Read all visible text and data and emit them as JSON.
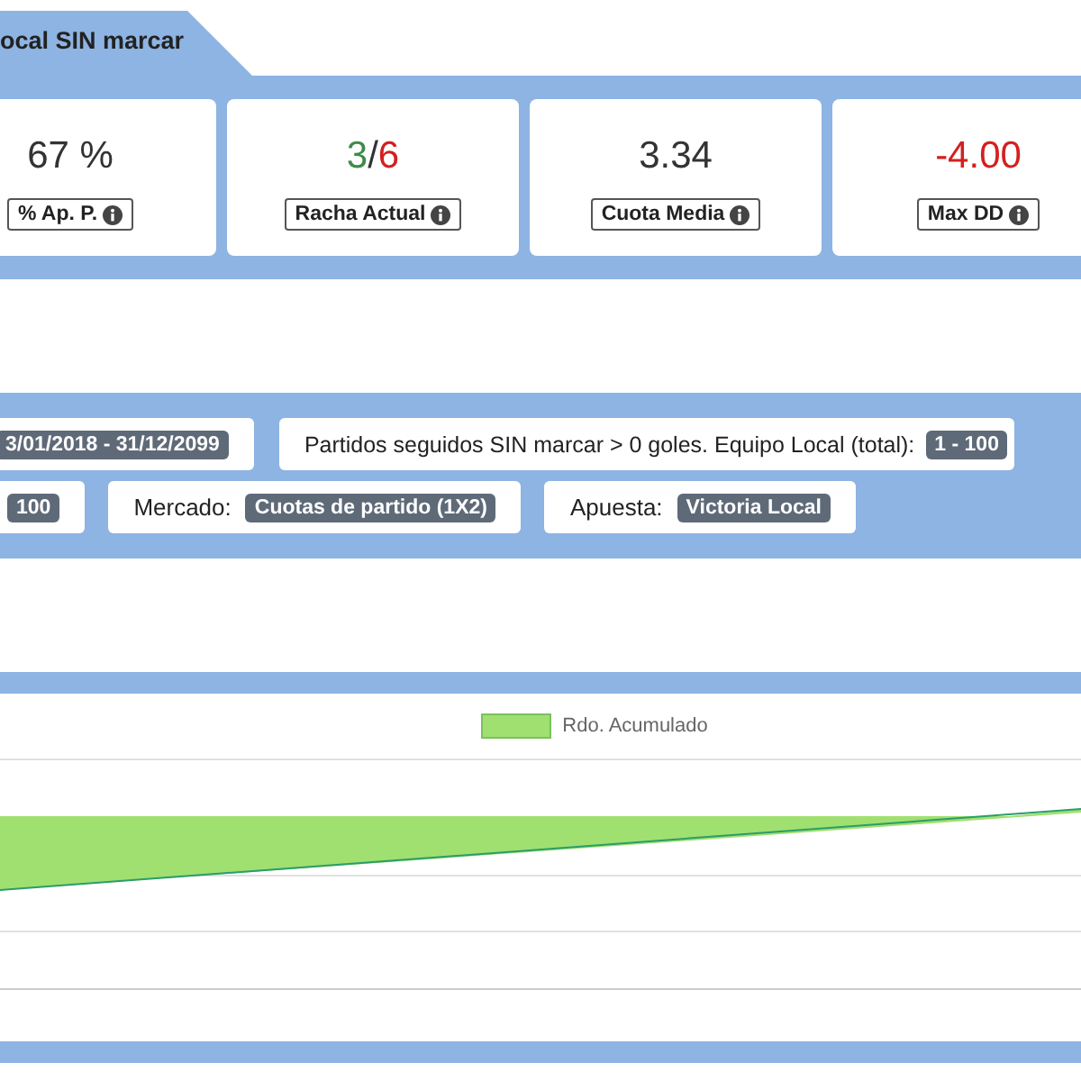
{
  "header": {
    "title": "ocal SIN marcar"
  },
  "stats": [
    {
      "kind": "plain",
      "value": "67 %",
      "label": "% Ap. P."
    },
    {
      "kind": "streak",
      "wins": "3",
      "separator": "/",
      "losses": "6",
      "label": "Racha Actual"
    },
    {
      "kind": "plain",
      "value": "3.34",
      "label": "Cuota Media"
    },
    {
      "kind": "negative",
      "value": "-4.00",
      "label": "Max DD"
    }
  ],
  "filters": [
    [
      {
        "badge": "3/01/2018 - 31/12/2099"
      },
      {
        "label": "Partidos seguidos SIN marcar > 0 goles. Equipo Local (total):",
        "badge": "1 - 100"
      }
    ],
    [
      {
        "badge": "100"
      },
      {
        "label": "Mercado:",
        "badge": "Cuotas de partido (1X2)"
      },
      {
        "label": "Apuesta:",
        "badge": "Victoria Local"
      }
    ]
  ],
  "chart": {
    "legend": "Rdo. Acumulado"
  }
}
